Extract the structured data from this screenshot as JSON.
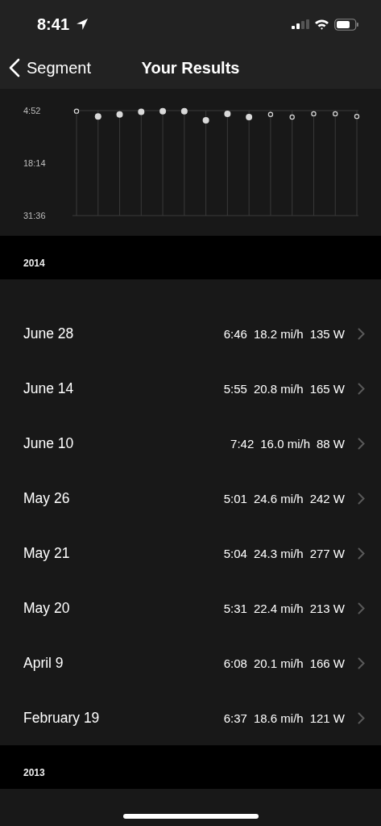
{
  "status_bar": {
    "time": "8:41"
  },
  "nav": {
    "back_label": "Segment",
    "title": "Your Results"
  },
  "results_chart": {
    "series_points": [
      {
        "filled": false
      },
      {
        "filled": true
      }
    ],
    "chart_data": {
      "type": "scatter",
      "ylim": [
        1896,
        292
      ],
      "yticks": [
        {
          "value": 292,
          "label": "4:52"
        },
        {
          "value": 1094,
          "label": "18:14"
        },
        {
          "value": 1896,
          "label": "31:36"
        }
      ],
      "series": [
        {
          "color": "#d9d9d9",
          "marker": "circle",
          "values": [
            300,
            null,
            null,
            null,
            null,
            null,
            null,
            null,
            null,
            350,
            390,
            340,
            340,
            380
          ]
        },
        {
          "color": "#d9d9d9",
          "marker": "circle",
          "values": [
            null,
            380,
            350,
            310,
            300,
            300,
            440,
            340,
            390,
            null,
            null,
            null,
            null,
            null
          ]
        }
      ]
    }
  },
  "sections": [
    {
      "year": "2014",
      "rows": [
        {
          "date": "June 28",
          "time": "6:46",
          "speed": "18.2 mi/h",
          "power": "135 W"
        },
        {
          "date": "June 14",
          "time": "5:55",
          "speed": "20.8 mi/h",
          "power": "165 W"
        },
        {
          "date": "June 10",
          "time": "7:42",
          "speed": "16.0 mi/h",
          "power": "88 W"
        },
        {
          "date": "May 26",
          "time": "5:01",
          "speed": "24.6 mi/h",
          "power": "242 W"
        },
        {
          "date": "May 21",
          "time": "5:04",
          "speed": "24.3 mi/h",
          "power": "277 W"
        },
        {
          "date": "May 20",
          "time": "5:31",
          "speed": "22.4 mi/h",
          "power": "213 W"
        },
        {
          "date": "April 9",
          "time": "6:08",
          "speed": "20.1 mi/h",
          "power": "166 W"
        },
        {
          "date": "February 19",
          "time": "6:37",
          "speed": "18.6 mi/h",
          "power": "121 W"
        }
      ]
    },
    {
      "year": "2013"
    }
  ]
}
